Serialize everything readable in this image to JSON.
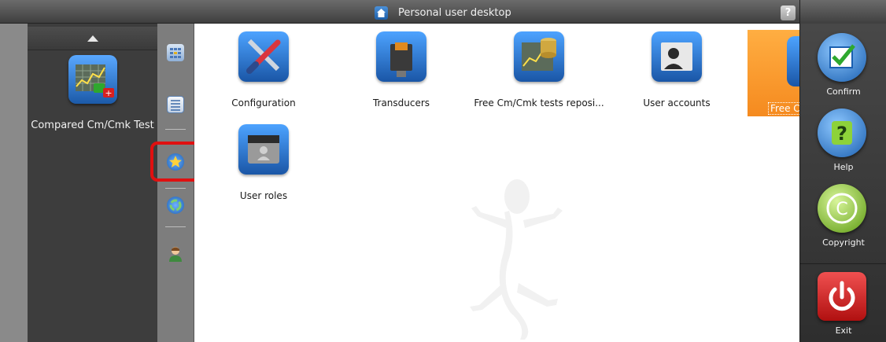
{
  "window": {
    "title": "Personal user desktop",
    "help_glyph": "?"
  },
  "left_panel": {
    "favorite_label": "Compared Cm/Cmk Test"
  },
  "tools": [
    "calendar-grid-icon",
    "list-icon",
    "favorites-star-icon",
    "recycle-icon",
    "user-icon"
  ],
  "tiles": [
    {
      "label": "Configuration",
      "icon": "tools-icon"
    },
    {
      "label": "Transducers",
      "icon": "transducer-icon"
    },
    {
      "label": "Free Cm/Cmk tests reposi...",
      "icon": "chart-database-icon"
    },
    {
      "label": "User accounts",
      "icon": "user-accounts-icon"
    },
    {
      "label": "Free C",
      "icon": "chart-icon"
    },
    {
      "label": "User roles",
      "icon": "user-roles-icon"
    }
  ],
  "actions": {
    "confirm": "Confirm",
    "help": "Help",
    "copyright": "Copyright",
    "exit": "Exit"
  },
  "colors": {
    "selection": "#f58a1f",
    "highlight_box": "#e01010",
    "icon_blue": "#1a56a6"
  }
}
